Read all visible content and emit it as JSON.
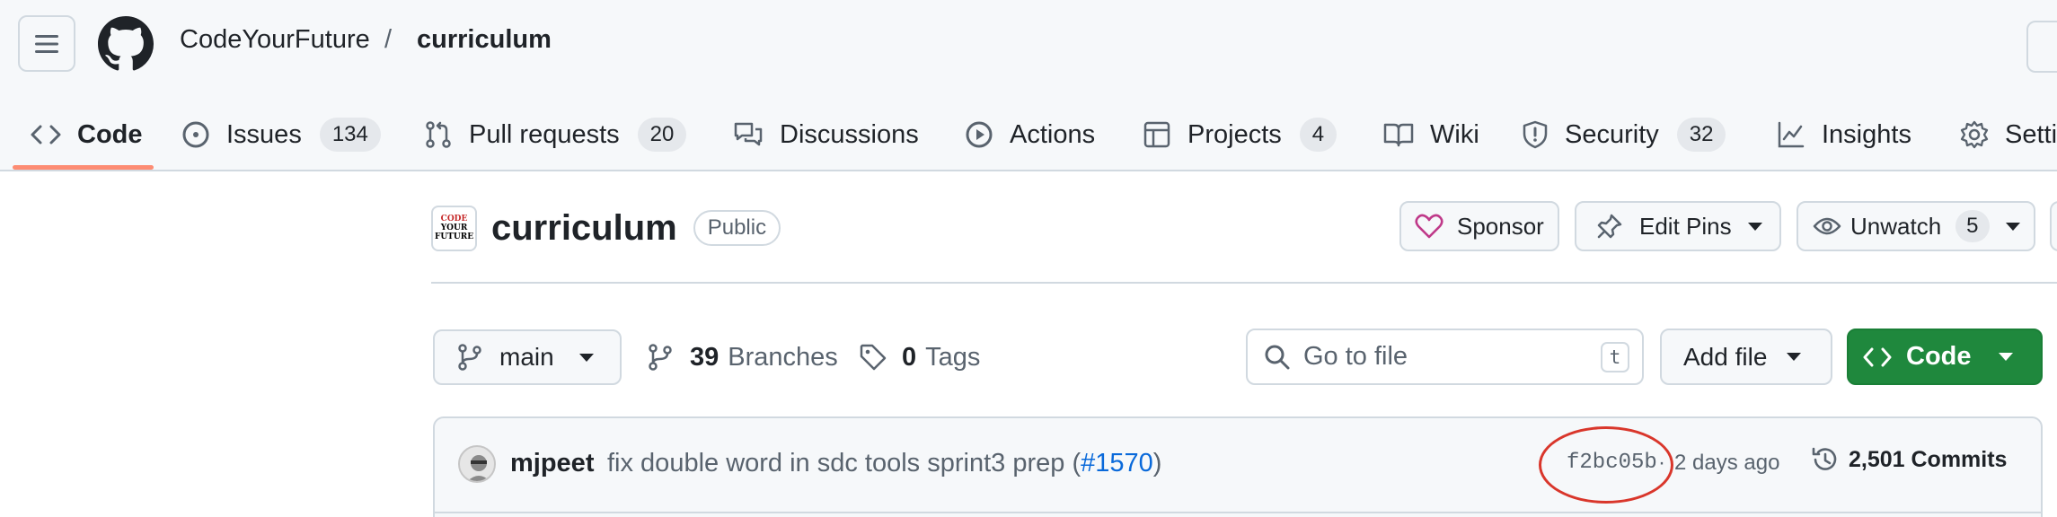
{
  "header": {
    "owner": "CodeYourFuture",
    "separator": "/",
    "repo": "curriculum"
  },
  "tabs": [
    {
      "label": "Code",
      "icon": "code-icon",
      "active": true
    },
    {
      "label": "Issues",
      "icon": "issue-icon",
      "count": "134"
    },
    {
      "label": "Pull requests",
      "icon": "pull-request-icon",
      "count": "20"
    },
    {
      "label": "Discussions",
      "icon": "discussions-icon"
    },
    {
      "label": "Actions",
      "icon": "play-icon"
    },
    {
      "label": "Projects",
      "icon": "table-icon",
      "count": "4"
    },
    {
      "label": "Wiki",
      "icon": "book-icon"
    },
    {
      "label": "Security",
      "icon": "shield-icon",
      "count": "32"
    },
    {
      "label": "Insights",
      "icon": "graph-icon"
    },
    {
      "label": "Setti",
      "icon": "gear-icon"
    }
  ],
  "repo": {
    "avatar_text": [
      "CODE",
      "YOUR",
      "FUTURE"
    ],
    "name": "curriculum",
    "visibility": "Public"
  },
  "actions": {
    "sponsor": "Sponsor",
    "edit_pins": "Edit Pins",
    "unwatch": "Unwatch",
    "watch_count": "5"
  },
  "toolbar": {
    "branch": "main",
    "branches_count": "39",
    "branches_label": "Branches",
    "tags_count": "0",
    "tags_label": "Tags",
    "search_placeholder": "Go to file",
    "search_shortcut": "t",
    "add_file": "Add file",
    "code": "Code"
  },
  "latest_commit": {
    "author": "mjpeet",
    "message": "fix double word in sdc tools sprint3 prep (",
    "pr": "#1570",
    "message_end": ")",
    "sha": "f2bc05b",
    "time": "2 days ago",
    "commits": "2,501 Commits"
  },
  "colors": {
    "accent_underline": "#fd8c73",
    "primary_green": "#1f883d",
    "link_blue": "#0969da",
    "annotation_red": "#d9362b",
    "sponsor_pink": "#bf3989"
  }
}
